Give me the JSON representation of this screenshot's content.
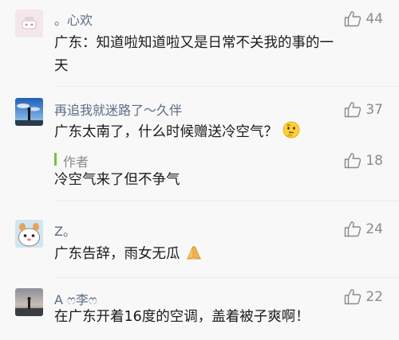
{
  "comments": [
    {
      "nickname": "。心欢",
      "likes": "44",
      "text_line1": "广东：知道啦知道啦又是日常不关我的事的一",
      "text_line2": "天"
    },
    {
      "nickname": "再追我就迷路了～久伴",
      "likes": "37",
      "text": "广东太南了，什么时候赠送冷空气？",
      "reply": {
        "author": "作者",
        "likes": "18",
        "text": "冷空气来了但不争气"
      }
    },
    {
      "nickname": "Z。",
      "likes": "24",
      "text": "广东告辞，雨女无瓜"
    },
    {
      "nickname": "A ෆ李ෆ",
      "likes": "22",
      "text": "在广东开着16度的空调，盖着被子爽啊！"
    }
  ],
  "icons": {
    "like": "thumbs-up-icon"
  },
  "colors": {
    "nickname": "#5c6b84",
    "text": "#1b1b1b",
    "meta": "#8a8a8a",
    "author_bar": "#7bbf3a"
  }
}
